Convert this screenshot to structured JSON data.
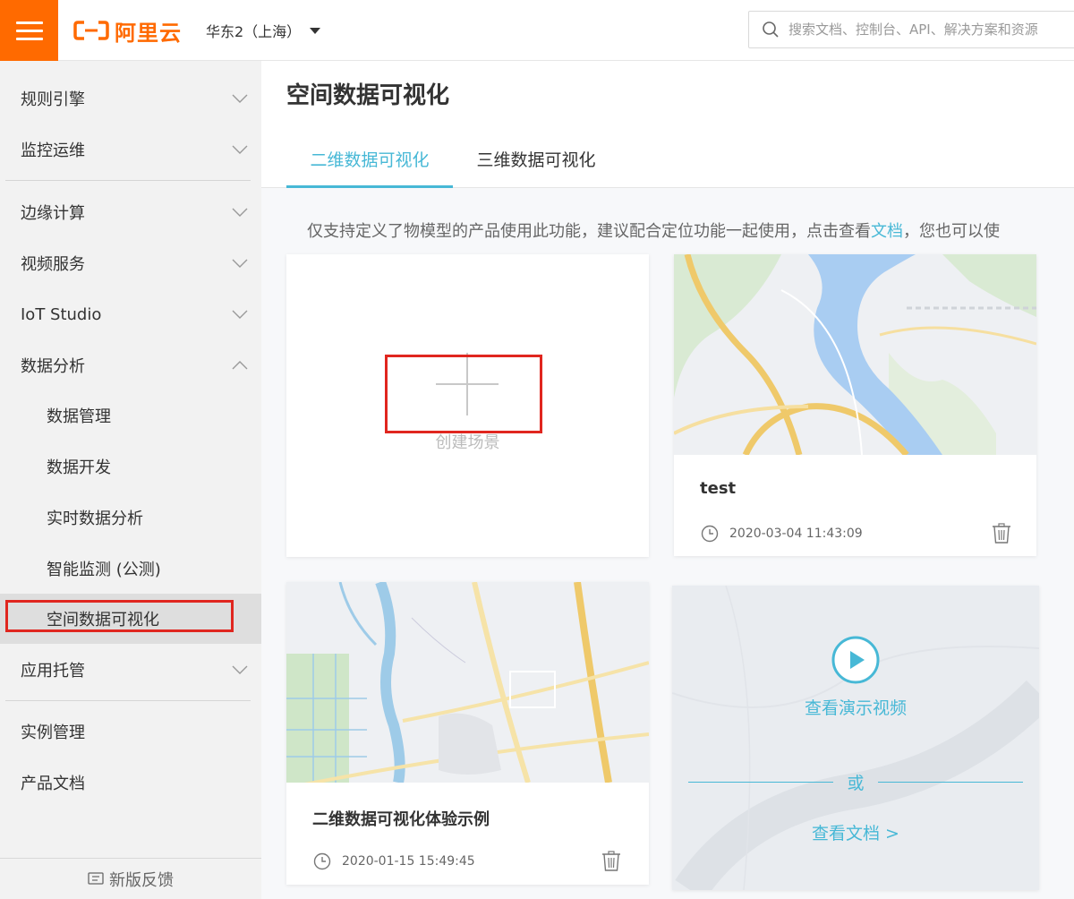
{
  "topbar": {
    "logo_text": "阿里云",
    "region": "华东2（上海）",
    "search_placeholder": "搜索文档、控制台、API、解决方案和资源"
  },
  "sidebar": {
    "items": [
      {
        "label": "规则引擎",
        "expanded": false
      },
      {
        "label": "监控运维",
        "expanded": false
      },
      {
        "label": "边缘计算",
        "expanded": false
      },
      {
        "label": "视频服务",
        "expanded": false
      },
      {
        "label": "IoT Studio",
        "expanded": false
      },
      {
        "label": "数据分析",
        "expanded": true
      },
      {
        "label": "数据管理"
      },
      {
        "label": "数据开发"
      },
      {
        "label": "实时数据分析"
      },
      {
        "label": "智能监测 (公测)"
      },
      {
        "label": "空间数据可视化",
        "active": true
      },
      {
        "label": "应用托管",
        "expanded": false
      },
      {
        "label": "实例管理"
      },
      {
        "label": "产品文档"
      }
    ],
    "feedback": "新版反馈"
  },
  "main": {
    "title": "空间数据可视化",
    "tabs": [
      {
        "label": "二维数据可视化",
        "active": true
      },
      {
        "label": "三维数据可视化",
        "active": false
      }
    ],
    "notice_prefix": "仅支持定义了物模型的产品使用此功能，建议配合定位功能一起使用，点击查看",
    "notice_link": "文档",
    "notice_suffix": "，您也可以使",
    "create_label": "创建场景",
    "cards": [
      {
        "title": "test",
        "time": "2020-03-04 11:43:09"
      },
      {
        "title": "二维数据可视化体验示例",
        "time": "2020-01-15 15:49:45"
      }
    ],
    "demo": {
      "video_label": "查看演示视频",
      "or_label": "或",
      "doc_label": "查看文档 >"
    }
  },
  "colors": {
    "brand": "#ff6a00",
    "accent": "#47b8d6",
    "highlight": "#e0261f"
  }
}
